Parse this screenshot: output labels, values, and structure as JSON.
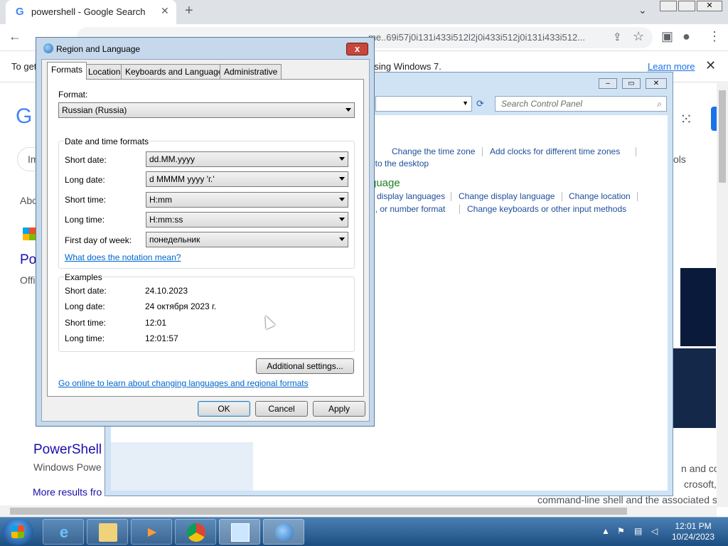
{
  "browser": {
    "tab_title": "powershell - Google Search",
    "url_fragment": "me..69i57j0i131i433i512l2j0i433i512j0i131i433i512...",
    "infobar_left": "To get",
    "infobar_right": "using Windows 7.",
    "learn_more": "Learn more"
  },
  "google_page": {
    "im": "Im",
    "abo": "Abo",
    "po": "Po",
    "offi": "Offi",
    "ols": "ols",
    "result_title": "PowerShell",
    "result_sub": "Windows Powe",
    "more_results": "More results fro",
    "snip1": "n and cor",
    "snip2": "crosoft, co",
    "snip3": "command-line shell and the associated s"
  },
  "control_panel": {
    "search_placeholder": "Search Control Panel",
    "links": {
      "change_time_zone": "Change the time zone",
      "add_clocks": "Add clocks for different time zones",
      "desktop": "t to the desktop",
      "heading": "guage",
      "display_languages": "display languages",
      "change_display_language": "Change display language",
      "change_location": "Change location",
      "number_format": "e, or number format",
      "keyboards": "Change keyboards or other input methods"
    }
  },
  "dialog": {
    "title": "Region and Language",
    "close": "x",
    "tabs": [
      "Formats",
      "Location",
      "Keyboards and Languages",
      "Administrative"
    ],
    "format_label": "Format:",
    "format_value": "Russian (Russia)",
    "dt_group": "Date and time formats",
    "short_date_label": "Short date:",
    "short_date_value": "dd.MM.yyyy",
    "long_date_label": "Long date:",
    "long_date_value": "d MMMM yyyy 'г.'",
    "short_time_label": "Short time:",
    "short_time_value": "H:mm",
    "long_time_label": "Long time:",
    "long_time_value": "H:mm:ss",
    "first_day_label": "First day of week:",
    "first_day_value": "понедельник",
    "notation_link": "What does the notation mean?",
    "examples_group": "Examples",
    "ex_short_date_label": "Short date:",
    "ex_short_date": "24.10.2023",
    "ex_long_date_label": "Long date:",
    "ex_long_date": "24 октября 2023 г.",
    "ex_short_time_label": "Short time:",
    "ex_short_time": "12:01",
    "ex_long_time_label": "Long time:",
    "ex_long_time": "12:01:57",
    "additional_settings": "Additional settings...",
    "online_link": "Go online to learn about changing languages and regional formats",
    "ok": "OK",
    "cancel": "Cancel",
    "apply": "Apply"
  },
  "taskbar": {
    "time": "12:01 PM",
    "date": "10/24/2023"
  },
  "colors": {
    "link": "#0066cc",
    "cp_link": "#1e4e9a",
    "cp_heading": "#1e7d1e",
    "close_red": "#c8463a"
  }
}
